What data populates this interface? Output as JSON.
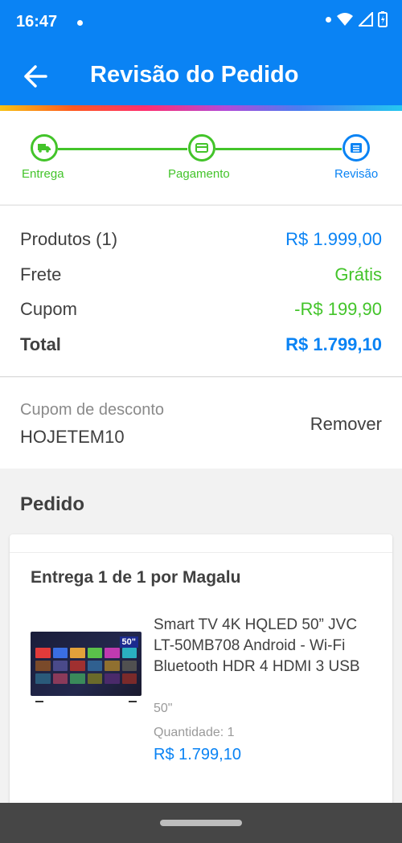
{
  "status_bar": {
    "time": "16:47"
  },
  "header": {
    "title": "Revisão do Pedido"
  },
  "steps": [
    {
      "label": "Entrega",
      "state": "done",
      "icon": "truck-icon"
    },
    {
      "label": "Pagamento",
      "state": "done",
      "icon": "card-icon"
    },
    {
      "label": "Revisão",
      "state": "active",
      "icon": "list-icon"
    }
  ],
  "summary": {
    "products_label": "Produtos (1)",
    "products_value": "R$ 1.999,00",
    "shipping_label": "Frete",
    "shipping_value": "Grátis",
    "coupon_label": "Cupom",
    "coupon_value": "-R$ 199,90",
    "total_label": "Total",
    "total_value": "R$ 1.799,10"
  },
  "coupon": {
    "label": "Cupom de desconto",
    "code": "HOJETEM10",
    "remove_label": "Remover"
  },
  "order": {
    "section_title": "Pedido",
    "delivery_title": "Entrega 1 de 1 por Magalu",
    "product": {
      "name": "Smart TV 4K HQLED 50” JVC LT-50MB708 Android - Wi-Fi Bluetooth HDR 4 HDMI 3 USB",
      "size": "50\"",
      "quantity_label": "Quantidade:",
      "quantity": "1",
      "price": "R$ 1.799,10",
      "badge": "50\""
    }
  },
  "colors": {
    "primary": "#0a83f4",
    "success": "#43c42a",
    "text": "#404040",
    "muted": "#8a8a8a"
  }
}
